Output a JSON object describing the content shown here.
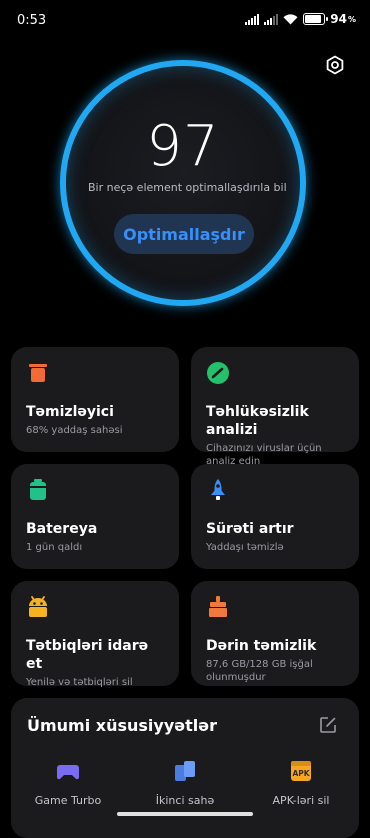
{
  "status_bar": {
    "time": "0:53",
    "battery_text": "94"
  },
  "score": {
    "value": "97",
    "subtitle": "Bir neçə element optimallaşdırıla bil",
    "button_label": "Optimallaşdır",
    "ring_color": "#21a8f2",
    "button_text_color": "#3a8ef7"
  },
  "tiles": [
    {
      "title": "Təmizləyici",
      "subtitle": "68% yaddaş sahəsi",
      "icon": "trash-icon",
      "color": "#f26a35"
    },
    {
      "title": "Təhlükəsizlik analizi",
      "subtitle": "Cihazınızı viruslar üçün analiz edin",
      "icon": "security-icon",
      "color": "#23c16b"
    },
    {
      "title": "Batereya",
      "subtitle": "1 gün  qaldı",
      "icon": "battery-icon",
      "color": "#23c18a"
    },
    {
      "title": "Sürəti artır",
      "subtitle": "Yaddaşı təmizlə",
      "icon": "rocket-icon",
      "color": "#3a8ef7"
    },
    {
      "title": "Tətbiqləri idarə et",
      "subtitle": "Yenilə və tətbiqləri sil",
      "icon": "android-icon",
      "color": "#f5b324"
    },
    {
      "title": "Dərin təmizlik",
      "subtitle": "87,6 GB/128 GB işğal olunmuşdur",
      "icon": "brush-icon",
      "color": "#f07a3d"
    }
  ],
  "general": {
    "title": "Ümumi xüsusiyyətlər",
    "items": [
      {
        "label": "Game Turbo",
        "icon": "gamepad-icon",
        "color": "#7a6cf0"
      },
      {
        "label": "İkinci sahə",
        "icon": "second-space-icon",
        "color": "#5a8cf2"
      },
      {
        "label": "APK-ləri sil",
        "icon": "apk-icon",
        "color": "#f5a623",
        "badge": "APK"
      }
    ]
  }
}
